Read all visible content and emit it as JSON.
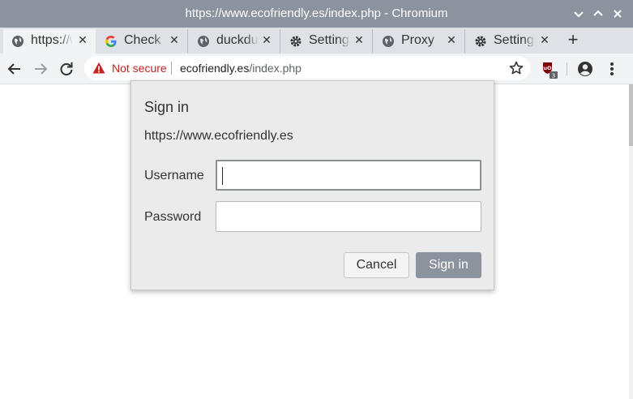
{
  "window": {
    "title": "https://www.ecofriendly.es/index.php - Chromium",
    "controls": [
      "chevron-down-icon",
      "chevron-up-icon",
      "close-icon"
    ]
  },
  "tabs": [
    {
      "label": "https://www.ecofriendly.es/index.php",
      "icon": "globe-icon",
      "active": true
    },
    {
      "label": "Check",
      "icon": "google-icon",
      "active": false
    },
    {
      "label": "duckduckgo",
      "icon": "globe-icon",
      "active": false
    },
    {
      "label": "Settings",
      "icon": "gear-icon",
      "active": false
    },
    {
      "label": "Proxy",
      "icon": "globe-icon",
      "active": false
    },
    {
      "label": "Settings",
      "icon": "gear-icon",
      "active": false
    }
  ],
  "new_tab_label": "+",
  "toolbar": {
    "security_label": "Not secure",
    "url_host": "ecofriendly.es",
    "url_path": "/index.php",
    "extension_badge": "3"
  },
  "dialog": {
    "title": "Sign in",
    "origin": "https://www.ecofriendly.es",
    "username_label": "Username",
    "username_value": "",
    "password_label": "Password",
    "password_value": "",
    "cancel_label": "Cancel",
    "signin_label": "Sign in"
  },
  "colors": {
    "titlebar": "#8b949e",
    "not_secure": "#c5221f",
    "primary_button": "#8b949e"
  }
}
